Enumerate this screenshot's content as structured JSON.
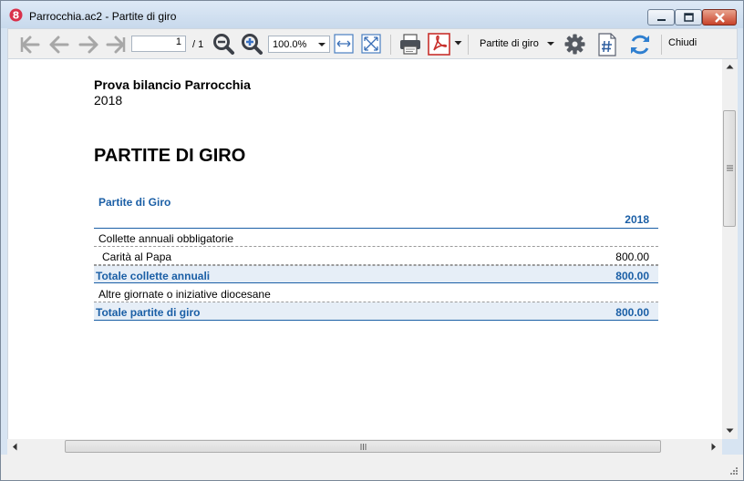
{
  "window": {
    "title": "Parrocchia.ac2 - Partite di giro"
  },
  "toolbar": {
    "page_current": "1",
    "page_total": "/ 1",
    "zoom": "100.0%",
    "report_name": "Partite di giro",
    "close_label": "Chiudi"
  },
  "document": {
    "organization": "Prova bilancio Parrocchia",
    "year": "2018",
    "heading": "PARTITE DI GIRO",
    "section": "Partite di Giro",
    "column_header": "2018",
    "rows": [
      {
        "label": "Collette annuali obbligatorie",
        "amount": ""
      },
      {
        "label": "Carità al Papa",
        "amount": "800.00"
      },
      {
        "label": "Totale collette annuali",
        "amount": "800.00"
      },
      {
        "label": "Altre giornate o iniziative diocesane",
        "amount": ""
      },
      {
        "label": "Totale partite di giro",
        "amount": "800.00"
      }
    ]
  },
  "colors": {
    "accent": "#1b5fa6",
    "total_row_bg": "#e6eef7"
  }
}
